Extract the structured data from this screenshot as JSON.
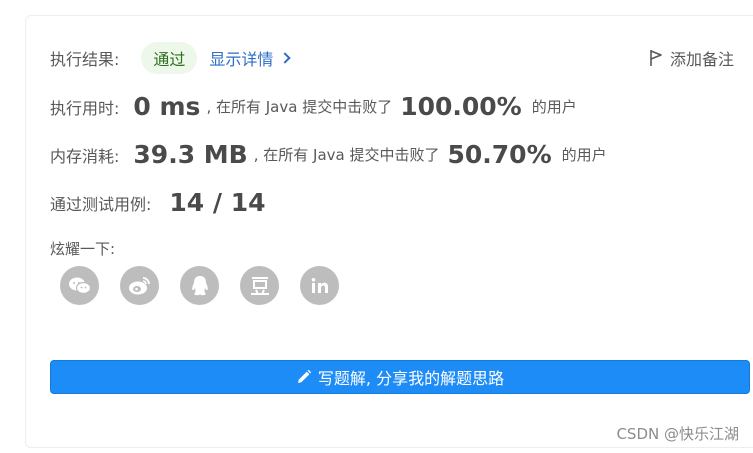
{
  "result": {
    "label": "执行结果:",
    "status": "通过",
    "detail_link": "显示详情",
    "note_button": "添加备注"
  },
  "runtime": {
    "label": "执行用时:",
    "value": "0 ms",
    "text_prefix": ", 在所有 Java 提交中击败了",
    "percent": "100.00%",
    "text_suffix": "的用户"
  },
  "memory": {
    "label": "内存消耗:",
    "value": "39.3 MB",
    "text_prefix": ", 在所有 Java 提交中击败了",
    "percent": "50.70%",
    "text_suffix": "的用户"
  },
  "testcases": {
    "label": "通过测试用例:",
    "value": "14 / 14"
  },
  "share": {
    "label": "炫耀一下:",
    "icons": [
      "wechat-icon",
      "weibo-icon",
      "qq-icon",
      "douban-icon",
      "linkedin-icon"
    ]
  },
  "write_button": {
    "label": "写题解, 分享我的解题思路"
  },
  "watermark": "CSDN @快乐江湖",
  "colors": {
    "accent": "#1e8cf7",
    "link": "#2b6dc4",
    "pass_bg": "#eef8ea",
    "pass_text": "#2e6e1f",
    "icon_bg": "#bdbdbd"
  }
}
